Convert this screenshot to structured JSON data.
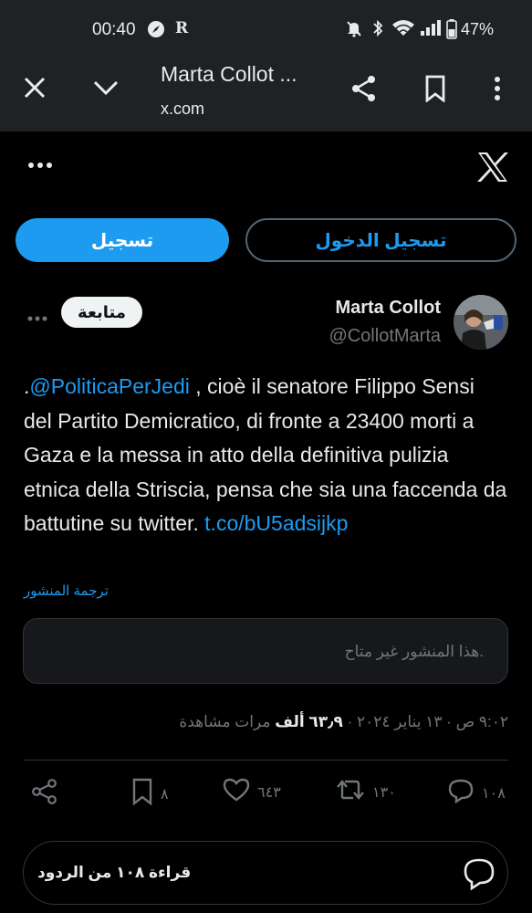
{
  "status_bar": {
    "time": "00:40",
    "battery": "47%",
    "icons": [
      "compass-icon",
      "r-icon",
      "mute-icon",
      "bluetooth-icon",
      "wifi-icon",
      "signal-icon",
      "battery-icon"
    ]
  },
  "browser": {
    "title": "Marta Collot ...",
    "url": "x.com",
    "icons": [
      "close-icon",
      "chevron-down-icon",
      "share-icon",
      "bookmark-icon",
      "more-vert-icon"
    ]
  },
  "header": {
    "signup_label": "تسجيل",
    "login_label": "تسجيل الدخول"
  },
  "tweet": {
    "author_name": "Marta Collot",
    "author_handle": "@CollotMarta",
    "follow_label": "متابعة",
    "mention": "@PoliticaPerJedi",
    "text_prefix": ".",
    "text_body": " , cioè il senatore Filippo Sensi del Partito Demicratico, di fronte a 23400 morti a Gaza e la messa in atto della definitiva pulizia etnica della Striscia, pensa che sia una faccenda da battutine su twitter. ",
    "link": "t.co/bU5adsijkp",
    "translate_label": "ترجمة المنشور",
    "unavailable_label": "هذا المنشور غير متاح.",
    "time": "٩:٠٢ ص",
    "date": "١٣ يناير ٢٠٢٤",
    "views_count": "٦٣٫٩ ألف",
    "views_label": "مرات مشاهدة",
    "separator": "·"
  },
  "actions": {
    "replies": "١٠٨",
    "retweets": "١٣٠",
    "likes": "٦٤٣",
    "bookmarks": "٨"
  },
  "replies_bar": {
    "label": "قراءة ١٠٨ من الردود"
  },
  "colors": {
    "accent": "#1d9bf0",
    "background": "#000000",
    "chrome": "#202124",
    "muted_text": "#71767b"
  }
}
